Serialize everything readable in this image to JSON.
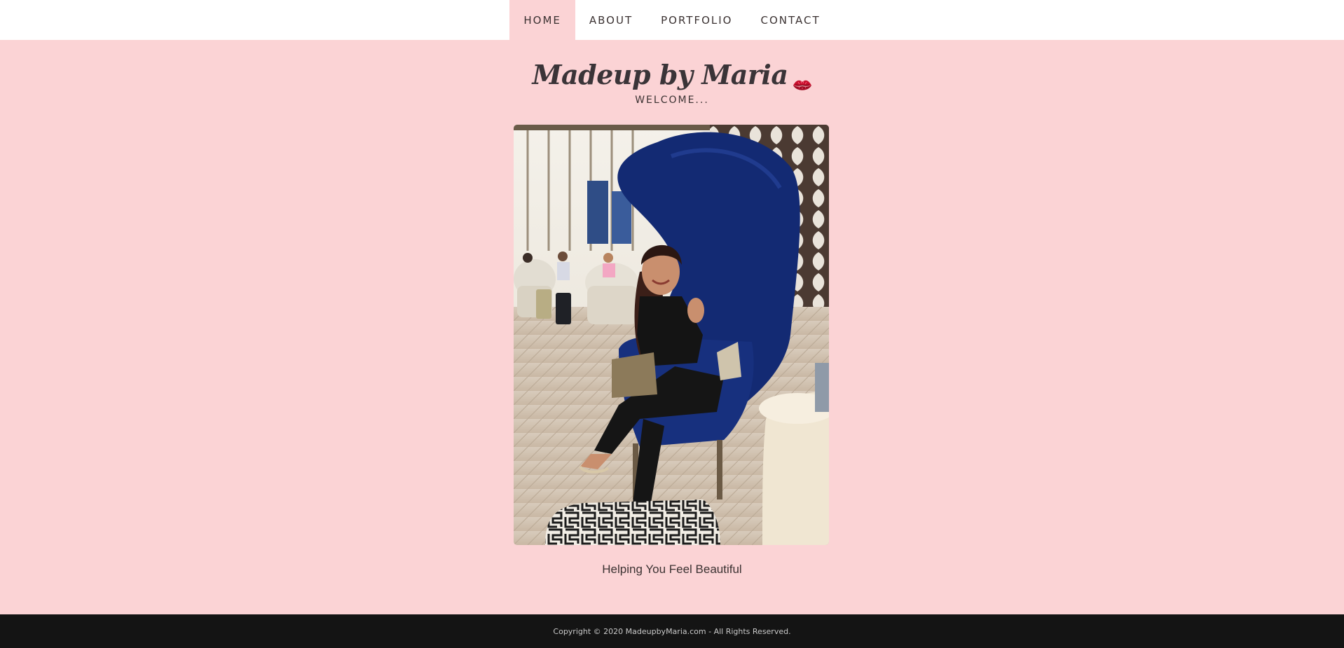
{
  "nav": {
    "items": [
      {
        "label": "HOME",
        "active": true
      },
      {
        "label": "ABOUT",
        "active": false
      },
      {
        "label": "PORTFOLIO",
        "active": false
      },
      {
        "label": "CONTACT",
        "active": false
      }
    ]
  },
  "header": {
    "title": "Madeup by Maria",
    "title_icon": "kiss-lips-icon",
    "subtitle": "WELCOME..."
  },
  "main": {
    "photo_subject": "portrait-photo",
    "caption": "Helping You Feel Beautiful"
  },
  "footer": {
    "copyright": "Copyright © 2020 MadeupbyMaria.com - All Rights Reserved."
  },
  "colors": {
    "background": "#fbd3d5",
    "nav_background": "#ffffff",
    "text": "#3b3232",
    "footer_background": "#141414",
    "accent_lips": "#c8102e"
  }
}
